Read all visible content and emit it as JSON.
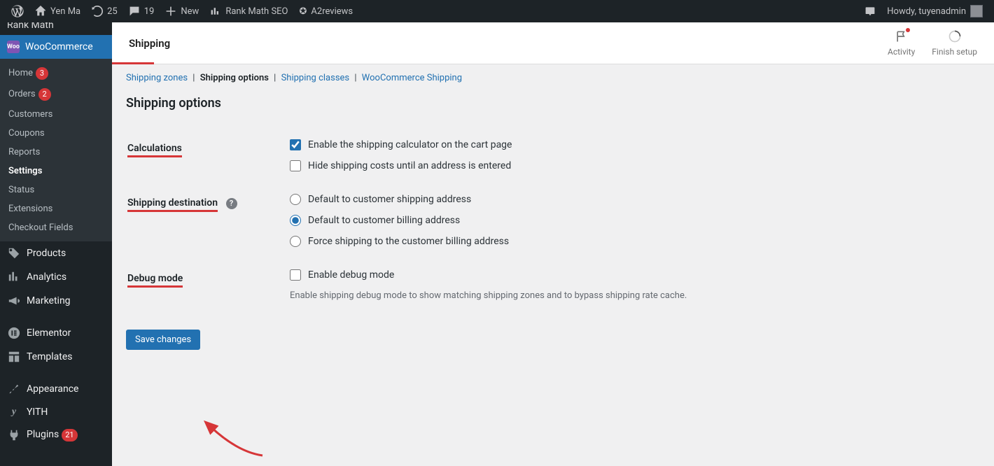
{
  "adminbar": {
    "site_name": "Yen Ma",
    "updates_count": "25",
    "comments_count": "19",
    "new_label": "New",
    "rank_math_label": "Rank Math SEO",
    "a2reviews_label": "A2reviews",
    "howdy_text": "Howdy, tuyenadmin"
  },
  "sidebar": {
    "truncated_top": "Rank Math",
    "woo_label": "WooCommerce",
    "woo_badge": "Woo",
    "submenu": {
      "home": "Home",
      "home_badge": "3",
      "orders": "Orders",
      "orders_badge": "2",
      "customers": "Customers",
      "coupons": "Coupons",
      "reports": "Reports",
      "settings": "Settings",
      "status": "Status",
      "extensions": "Extensions",
      "checkout_fields": "Checkout Fields"
    },
    "products": "Products",
    "analytics": "Analytics",
    "marketing": "Marketing",
    "elementor": "Elementor",
    "templates": "Templates",
    "appearance": "Appearance",
    "yith": "YITH",
    "plugins": "Plugins",
    "plugins_badge": "21"
  },
  "header": {
    "title": "Shipping",
    "activity": "Activity",
    "finish_setup": "Finish setup"
  },
  "tabs": {
    "zones": "Shipping zones",
    "options": "Shipping options",
    "classes": "Shipping classes",
    "wc_shipping": "WooCommerce Shipping"
  },
  "page": {
    "heading": "Shipping options",
    "calculations_label": "Calculations",
    "calc_enable": "Enable the shipping calculator on the cart page",
    "calc_hide": "Hide shipping costs until an address is entered",
    "destination_label": "Shipping destination",
    "dest_shipping": "Default to customer shipping address",
    "dest_billing": "Default to customer billing address",
    "dest_force": "Force shipping to the customer billing address",
    "debug_label": "Debug mode",
    "debug_enable": "Enable debug mode",
    "debug_desc": "Enable shipping debug mode to show matching shipping zones and to bypass shipping rate cache.",
    "save_button": "Save changes"
  }
}
